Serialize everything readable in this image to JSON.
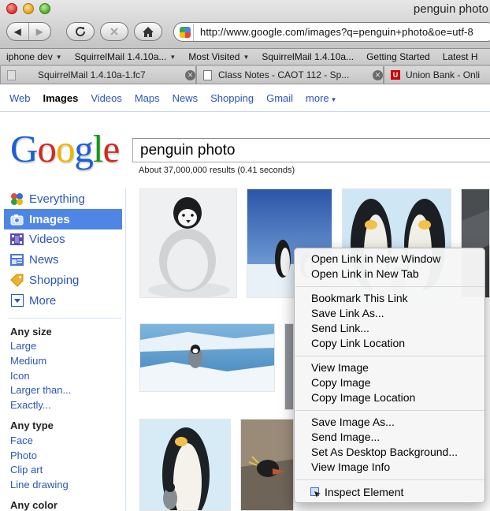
{
  "browser": {
    "window_title": "penguin photo",
    "url": "http://www.google.com/images?q=penguin+photo&oe=utf-8",
    "bookmarks": [
      {
        "label": "iphone dev",
        "has_menu": true
      },
      {
        "label": "SquirrelMail 1.4.10a...",
        "has_menu": true
      },
      {
        "label": "Most Visited",
        "has_menu": true
      },
      {
        "label": "SquirrelMail 1.4.10a...",
        "has_menu": false
      },
      {
        "label": "Getting Started",
        "has_menu": false
      },
      {
        "label": "Latest H",
        "has_menu": false
      }
    ],
    "tabs": [
      {
        "label": "SquirrelMail 1.4.10a-1.fc7"
      },
      {
        "label": "Class Notes - CAOT 112 - Sp..."
      },
      {
        "label": "Union Bank - Onli"
      }
    ]
  },
  "google_bar": {
    "links": [
      "Web",
      "Images",
      "Videos",
      "Maps",
      "News",
      "Shopping",
      "Gmail"
    ],
    "active": "Images",
    "more_label": "more"
  },
  "search": {
    "query": "penguin photo",
    "result_stats": "About 37,000,000 results (0.41 seconds)"
  },
  "left_nav": {
    "items": [
      {
        "label": "Everything",
        "icon": "everything-icon"
      },
      {
        "label": "Images",
        "icon": "camera-icon"
      },
      {
        "label": "Videos",
        "icon": "film-icon"
      },
      {
        "label": "News",
        "icon": "news-icon"
      },
      {
        "label": "Shopping",
        "icon": "shopping-tag-icon"
      },
      {
        "label": "More",
        "icon": "more-dropdown-icon"
      }
    ],
    "active": "Images",
    "size_heading": "Any size",
    "size_options": [
      "Large",
      "Medium",
      "Icon",
      "Larger than...",
      "Exactly..."
    ],
    "type_heading": "Any type",
    "type_options": [
      "Face",
      "Photo",
      "Clip art",
      "Line drawing"
    ],
    "color_heading": "Any color"
  },
  "context_menu": {
    "groups": [
      [
        "Open Link in New Window",
        "Open Link in New Tab"
      ],
      [
        "Bookmark This Link",
        "Save Link As...",
        "Send Link...",
        "Copy Link Location"
      ],
      [
        "View Image",
        "Copy Image",
        "Copy Image Location"
      ],
      [
        "Save Image As...",
        "Send Image...",
        "Set As Desktop Background...",
        "View Image Info"
      ],
      [
        "Inspect Element"
      ]
    ]
  },
  "colors": {
    "link_blue": "#2a55b8",
    "active_nav_bg": "#4f86e6",
    "menu_bg": "#f6f6f6"
  }
}
